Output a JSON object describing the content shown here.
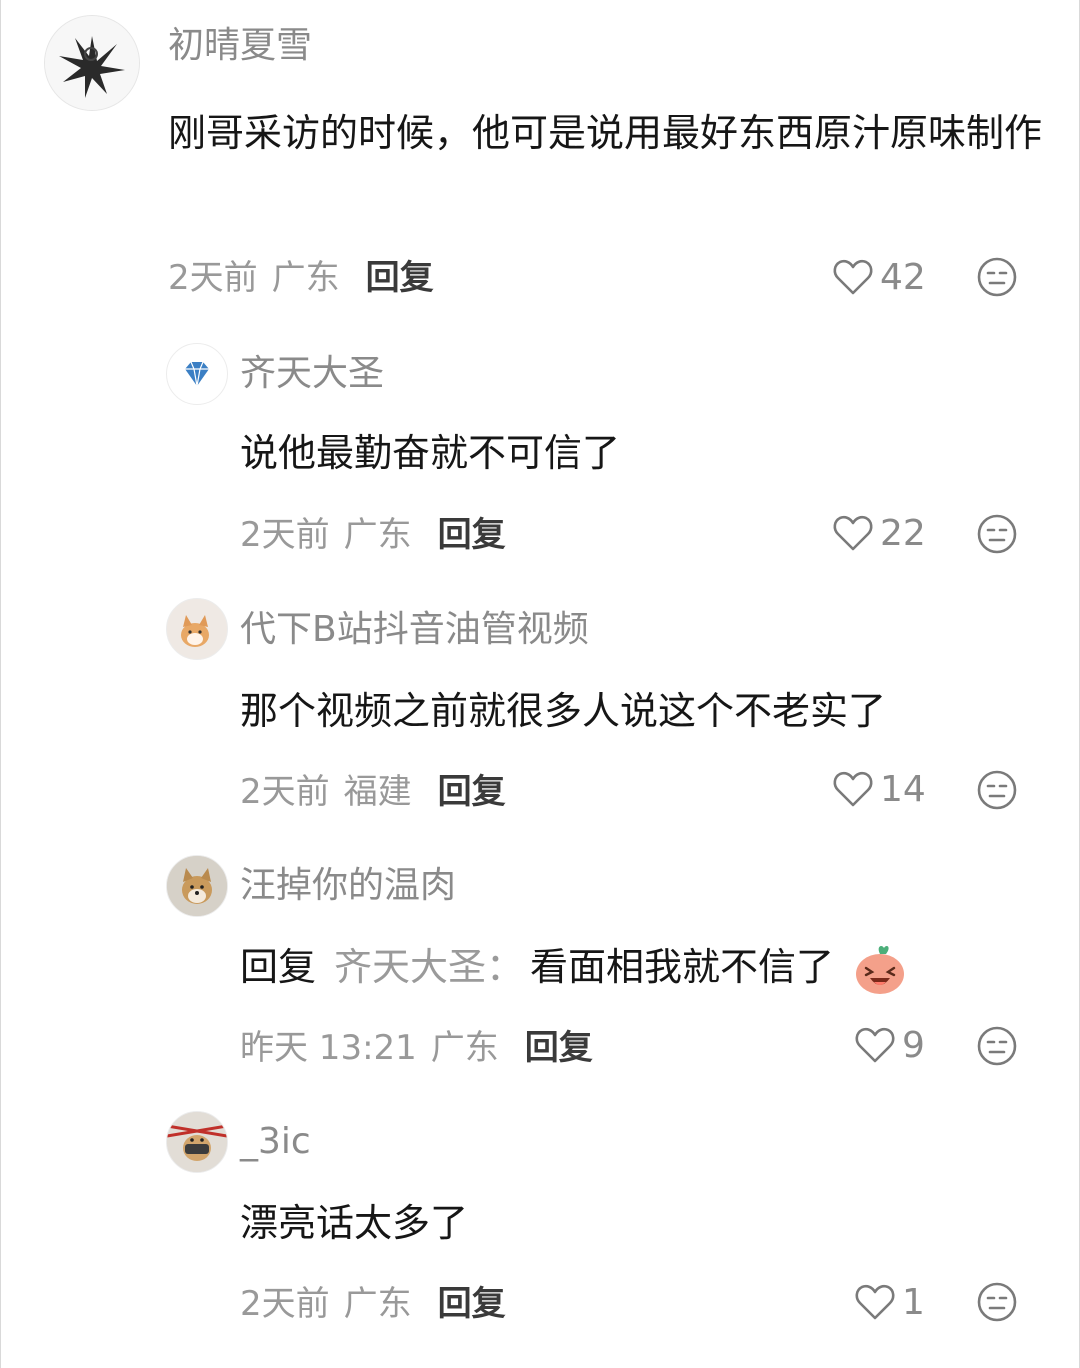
{
  "comments": [
    {
      "username": "初晴夏雪",
      "text": "刚哥采访的时候，他可是说用最好东西原汁原味制作",
      "time": "2天前",
      "location": "广东",
      "reply": "回复",
      "likes": "42"
    },
    {
      "username": "齐天大圣",
      "text": "说他最勤奋就不可信了",
      "time": "2天前",
      "location": "广东",
      "reply": "回复",
      "likes": "22"
    },
    {
      "username": "代下B站抖音油管视频",
      "text": "那个视频之前就很多人说这个不老实了",
      "time": "2天前",
      "location": "福建",
      "reply": "回复",
      "likes": "14"
    },
    {
      "username": "汪掉你的温肉",
      "reply_prefix": "回复",
      "reply_to": "齐天大圣：",
      "text": "看面相我就不信了",
      "time": "昨天 13:21",
      "location": "广东",
      "reply": "回复",
      "likes": "9"
    },
    {
      "username": "_3ic",
      "text": "漂亮话太多了",
      "time": "2天前",
      "location": "广东",
      "reply": "回复",
      "likes": "1"
    }
  ],
  "icons": {
    "like": "heart-outline-icon",
    "dislike": "neutral-face-icon",
    "emoji": "laughing-peach-emoji"
  }
}
